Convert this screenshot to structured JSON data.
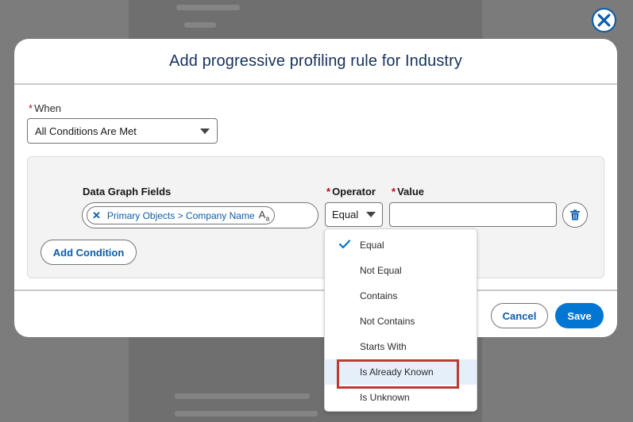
{
  "modal": {
    "title": "Add progressive profiling rule for Industry"
  },
  "when": {
    "label": "When",
    "required_marker": "*",
    "selected": "All Conditions Are Met"
  },
  "condition": {
    "fields_label": "Data Graph Fields",
    "operator_label": "Operator",
    "value_label": "Value",
    "required_marker": "*",
    "field_pill": {
      "text": "Primary Objects > Company Name",
      "type_glyph": "A",
      "type_glyph_sub": "a"
    },
    "operator_selected": "Equal",
    "value": "",
    "add_condition_label": "Add Condition"
  },
  "footer": {
    "cancel_label": "Cancel",
    "save_label": "Save"
  },
  "operator_dropdown": {
    "options": [
      "Equal",
      "Not Equal",
      "Contains",
      "Not Contains",
      "Starts With",
      "Is Already Known",
      "Is Unknown"
    ],
    "checked_option": "Equal",
    "highlighted_option": "Is Already Known"
  },
  "icons": {
    "close": "close-icon",
    "caret": "chevron-down-icon",
    "delete": "trash-icon",
    "check": "check-icon",
    "remove_pill": "close-icon",
    "text_type": "text-type-icon"
  },
  "colors": {
    "brand": "#0176d3",
    "link": "#0b5cab",
    "title": "#16325c",
    "required": "#ba0517",
    "highlight_box": "#c23934",
    "highlight_row": "#e5effa"
  }
}
